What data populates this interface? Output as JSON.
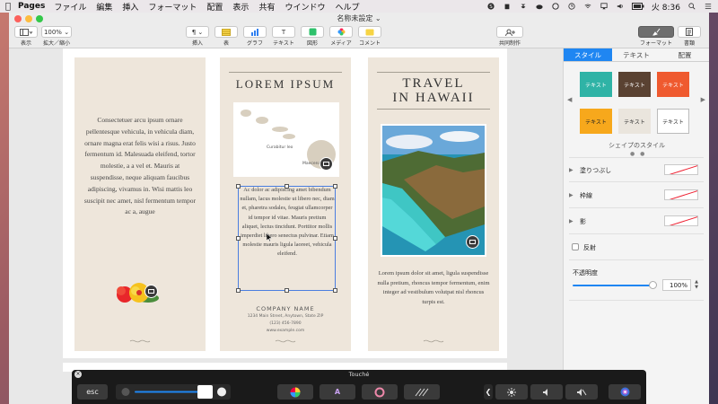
{
  "menubar": {
    "app_name": "Pages",
    "items": [
      "ファイル",
      "編集",
      "挿入",
      "フォーマット",
      "配置",
      "表示",
      "共有",
      "ウインドウ",
      "ヘルプ"
    ],
    "clock": "火 8:36"
  },
  "window": {
    "title": "名称未設定 ⌄"
  },
  "toolbar": {
    "view_label": "表示",
    "zoom_value": "100%",
    "zoom_label": "拡大／縮小",
    "insert_label": "挿入",
    "table_label": "表",
    "chart_label": "グラフ",
    "text_label": "テキスト",
    "shape_label": "図形",
    "media_label": "メディア",
    "comment_label": "コメント",
    "collab_label": "共同制作",
    "format_label": "フォーマット",
    "document_label": "書類"
  },
  "document": {
    "panel1": {
      "body": "Consectetuer arcu ipsum ornare pellentesque vehicula, in vehicula diam, ornare magna erat felis wisi a risus. Justo fermentum id. Malesuada eleifend, tortor molestie, a a vel et. Mauris at suspendisse, neque aliquam faucibus adipiscing, vivamus in. Wisi mattis leo suscipit nec amet, nisl fermentum tempor ac a, augue"
    },
    "panel2": {
      "title": "LOREM IPSUM",
      "map_label_1": "Curabitur leo",
      "map_label_2": "Maecenas",
      "body": "Ac dolor ac adipiscing amet bibendum nullam, lacus molestie ut libero nec, diam et, pharetra sodales, feugiat ullamcorper id tempor id vitae. Mauris pretium aliquet, lectus tincidunt. Porttitor mollis imperdiet libero senectus pulvinar. Etiam molestie mauris ligula laoreet, vehicula eleifend.",
      "company": "COMPANY NAME",
      "address": "1234 Main Street, Anytown, State ZIP",
      "phone": "(123) 456-7890",
      "web": "www.example.com"
    },
    "panel3": {
      "title_line1": "TRAVEL",
      "title_line2": "IN HAWAII",
      "body": "Lorem ipsum dolor sit amet, ligula suspendisse nulla pretium, rhoncus tempor fermentum, enim integer ad vestibulum volutpat nisl rhoncus turpis est."
    }
  },
  "inspector": {
    "tabs": [
      "スタイル",
      "テキスト",
      "配置"
    ],
    "active_tab": "スタイル",
    "swatches": [
      {
        "label": "テキスト",
        "bg": "#2fb3a6",
        "fg": "#ffffff"
      },
      {
        "label": "テキスト",
        "bg": "#5a4232",
        "fg": "#ffffff"
      },
      {
        "label": "テキスト",
        "bg": "#ef5a2f",
        "fg": "#ffffff"
      },
      {
        "label": "テキスト",
        "bg": "#f7a81c",
        "fg": "#222222"
      },
      {
        "label": "テキスト",
        "bg": "#eae5dd",
        "fg": "#333333"
      },
      {
        "label": "テキスト",
        "bg": "#ffffff",
        "fg": "#333333"
      }
    ],
    "shape_styles_label": "シェイプのスタイル",
    "fill_label": "塗りつぶし",
    "border_label": "枠線",
    "shadow_label": "影",
    "reflection_label": "反射",
    "opacity_label": "不透明度",
    "opacity_value": "100%"
  },
  "touchbar": {
    "title": "Touché",
    "esc_label": "esc"
  },
  "colors": {
    "accent": "#1f86f2",
    "panel_bg": "#eee6db"
  }
}
